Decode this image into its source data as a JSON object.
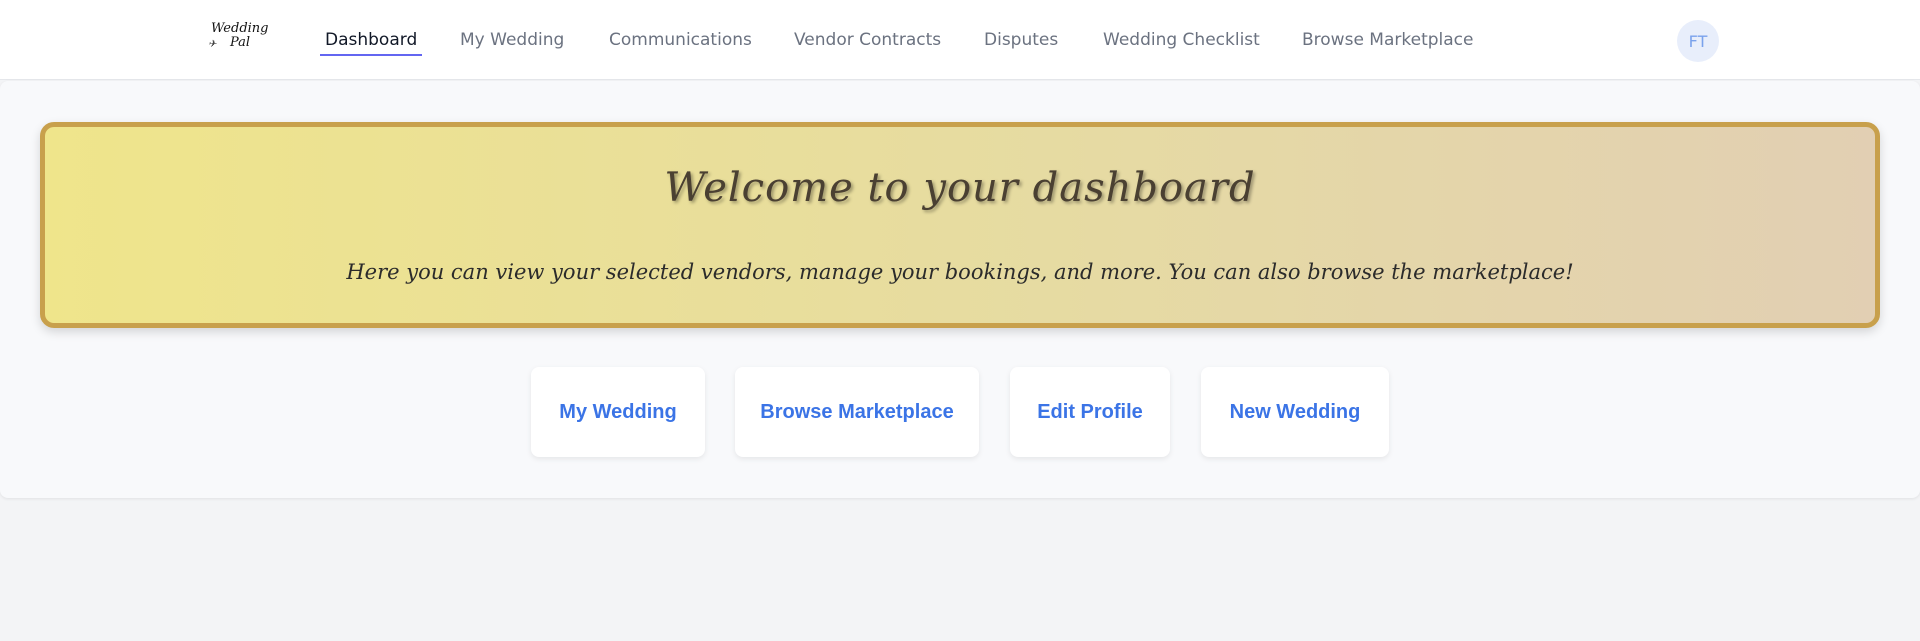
{
  "logo": {
    "line1": "Wedding",
    "line2": "Pal"
  },
  "nav": {
    "items": [
      {
        "label": "Dashboard",
        "active": true
      },
      {
        "label": "My Wedding"
      },
      {
        "label": "Communications"
      },
      {
        "label": "Vendor Contracts"
      },
      {
        "label": "Disputes"
      },
      {
        "label": "Wedding Checklist"
      },
      {
        "label": "Browse Marketplace"
      }
    ],
    "avatar_initials": "FT"
  },
  "banner": {
    "title": "Welcome to your dashboard",
    "text": "Here you can view your selected vendors, manage your bookings, and more. You can also browse the marketplace!"
  },
  "actions": {
    "my_wedding": "My Wedding",
    "browse_marketplace": "Browse Marketplace",
    "edit_profile": "Edit Profile",
    "new_wedding": "New Wedding"
  },
  "colors": {
    "accent": "#3b74e6",
    "nav_underline": "#6366f1",
    "banner_border": "#c8a04c"
  }
}
